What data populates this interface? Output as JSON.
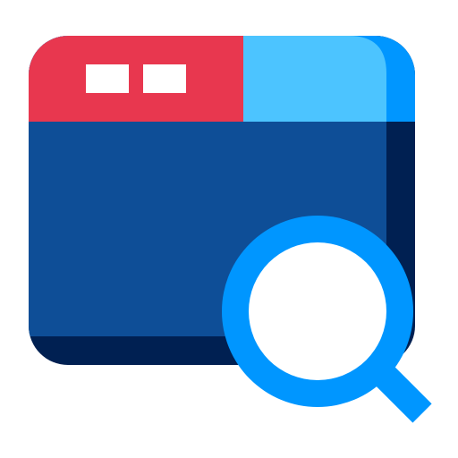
{
  "icon": {
    "name": "browser-search-icon",
    "colors": {
      "titlebar_left": "#E8374F",
      "titlebar_right": "#4CC4FF",
      "titlebar_right_edge": "#0096FF",
      "window_body": "#0E4E97",
      "window_shadow": "#002052",
      "window_buttons": "#FFFFFF",
      "magnifier_ring": "#0096FF",
      "magnifier_lens": "#FFFFFF"
    }
  }
}
